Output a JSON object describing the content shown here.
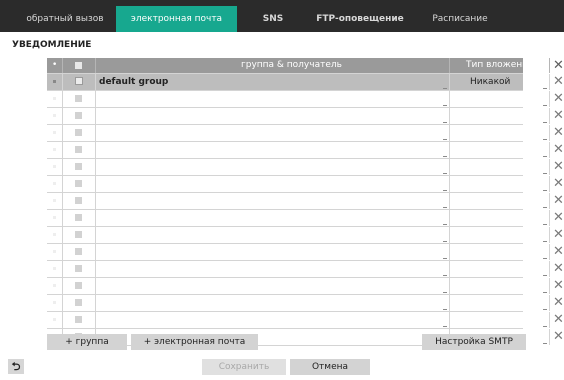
{
  "tabs": [
    {
      "label": "обратный вызов",
      "active": false
    },
    {
      "label": "электронная почта",
      "active": true
    },
    {
      "label": "SNS",
      "active": false
    },
    {
      "label": "FTP-оповещение",
      "active": false
    },
    {
      "label": "Расписание",
      "active": false
    }
  ],
  "section_title": "УВЕДОМЛЕНИЕ",
  "table": {
    "header": {
      "dot": "•",
      "group_recipient": "группа   & получатель",
      "attachment_type": "Тип вложения",
      "delete": "✕"
    },
    "rows": [
      {
        "group": "default group",
        "attachment": "Никакой",
        "selected": true
      },
      {
        "group": "",
        "attachment": "",
        "selected": false
      },
      {
        "group": "",
        "attachment": "",
        "selected": false
      },
      {
        "group": "",
        "attachment": "",
        "selected": false
      },
      {
        "group": "",
        "attachment": "",
        "selected": false
      },
      {
        "group": "",
        "attachment": "",
        "selected": false
      },
      {
        "group": "",
        "attachment": "",
        "selected": false
      },
      {
        "group": "",
        "attachment": "",
        "selected": false
      },
      {
        "group": "",
        "attachment": "",
        "selected": false
      },
      {
        "group": "",
        "attachment": "",
        "selected": false
      },
      {
        "group": "",
        "attachment": "",
        "selected": false
      },
      {
        "group": "",
        "attachment": "",
        "selected": false
      },
      {
        "group": "",
        "attachment": "",
        "selected": false
      },
      {
        "group": "",
        "attachment": "",
        "selected": false
      },
      {
        "group": "",
        "attachment": "",
        "selected": false
      },
      {
        "group": "",
        "attachment": "",
        "selected": false
      }
    ],
    "delete_glyph": "✕"
  },
  "buttons": {
    "add_group": "+ группа",
    "add_email": "+ электронная почта",
    "smtp_settings": "Настройка SMTP",
    "save": "Сохранить",
    "cancel": "Отмена",
    "back_icon": "back-arrow-icon",
    "back_glyph": "⮌"
  },
  "colors": {
    "tab_bar": "#2b2b2b",
    "active_tab": "#17a88f",
    "table_header": "#9a9a9a",
    "selected_row": "#bdbdbd",
    "button": "#d3d3d3"
  }
}
